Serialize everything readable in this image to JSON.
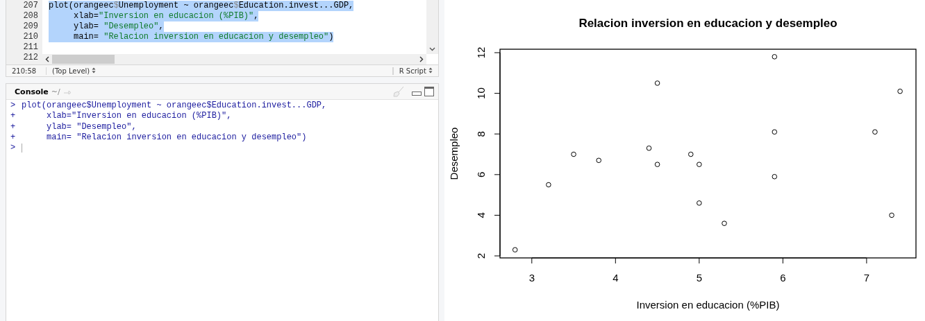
{
  "editor": {
    "lines": [
      {
        "number": "207",
        "selected": true,
        "segments": [
          {
            "kind": "code",
            "text": "plot(orangeec"
          },
          {
            "kind": "dollar",
            "text": "$"
          },
          {
            "kind": "code",
            "text": "Unemployment ~ orangeec"
          },
          {
            "kind": "dollar",
            "text": "$"
          },
          {
            "kind": "code",
            "text": "Education.invest...GDP,"
          }
        ]
      },
      {
        "number": "208",
        "selected": true,
        "segments": [
          {
            "kind": "code",
            "text": "     xlab="
          },
          {
            "kind": "string",
            "text": "\"Inversion en educacion (%PIB)\""
          },
          {
            "kind": "code",
            "text": ","
          }
        ]
      },
      {
        "number": "209",
        "selected": true,
        "segments": [
          {
            "kind": "code",
            "text": "     ylab= "
          },
          {
            "kind": "string",
            "text": "\"Desempleo\""
          },
          {
            "kind": "code",
            "text": ","
          }
        ]
      },
      {
        "number": "210",
        "selected": true,
        "segments": [
          {
            "kind": "code",
            "text": "     main= "
          },
          {
            "kind": "string",
            "text": "\"Relacion inversion en educacion y desempleo\""
          },
          {
            "kind": "code",
            "text": ")"
          }
        ]
      },
      {
        "number": "211",
        "selected": false
      },
      {
        "number": "212"
      }
    ],
    "cursor_position": "210:58",
    "scope": "(Top Level)",
    "file_type": "R Script"
  },
  "console": {
    "title": "Console",
    "path": "~/",
    "lines": [
      {
        "prompt": ">",
        "text": "plot(orangeec$Unemployment ~ orangeec$Education.invest...GDP,"
      },
      {
        "prompt": "+",
        "text": "     xlab=\"Inversion en educacion (%PIB)\","
      },
      {
        "prompt": "+",
        "text": "     ylab= \"Desempleo\","
      },
      {
        "prompt": "+",
        "text": "     main= \"Relacion inversion en educacion y desempleo\")"
      },
      {
        "prompt": ">"
      }
    ]
  },
  "plot": {
    "chart_data": {
      "type": "scatter",
      "title": "Relacion inversion en educacion y desempleo",
      "xlabel": "Inversion en educacion (%PIB)",
      "ylabel": "Desempleo",
      "xlim": [
        2.62,
        7.59
      ],
      "ylim": [
        1.9,
        12.17
      ],
      "xticks": [
        3,
        4,
        5,
        6,
        7
      ],
      "yticks": [
        2,
        4,
        6,
        8,
        10,
        12
      ],
      "x": [
        2.8,
        3.2,
        3.5,
        3.8,
        4.4,
        4.5,
        4.5,
        4.9,
        5.0,
        5.0,
        5.3,
        5.9,
        5.9,
        5.9,
        7.1,
        7.3,
        7.4
      ],
      "series": [
        {
          "color": "#000000",
          "values": [
            2.3,
            5.5,
            7.0,
            6.7,
            7.3,
            10.5,
            6.5,
            7.0,
            6.5,
            4.6,
            3.6,
            11.8,
            8.1,
            5.9,
            8.1,
            4.0,
            10.1
          ]
        }
      ]
    }
  }
}
